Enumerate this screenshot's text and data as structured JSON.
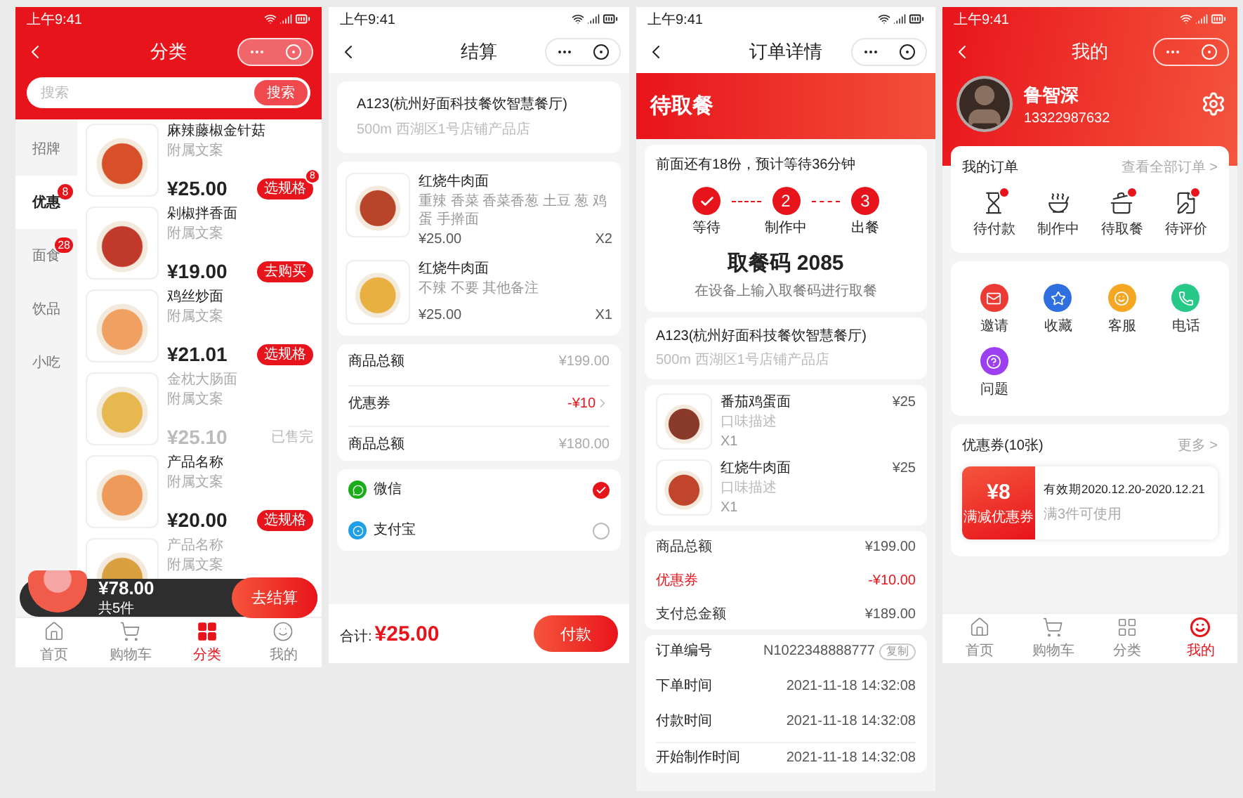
{
  "screens": [
    {
      "kind": "category",
      "status_time": "上午9:41",
      "title": "分类",
      "search": {
        "placeholder": "搜索",
        "button": "搜索"
      },
      "categories": [
        {
          "label": "招牌",
          "selected": false
        },
        {
          "label": "优惠",
          "selected": true,
          "badge": "8"
        },
        {
          "label": "面食",
          "selected": false,
          "badge": "28"
        },
        {
          "label": "饮品",
          "selected": false
        },
        {
          "label": "小吃",
          "selected": false
        }
      ],
      "products": [
        {
          "name": "麻辣藤椒金针菇",
          "subtitle": "附属文案",
          "price": "¥25.00",
          "action": "选规格",
          "sold_out": false,
          "badge": "8"
        },
        {
          "name": "剁椒拌香面",
          "subtitle": "附属文案",
          "price": "¥19.00",
          "action": "去购买",
          "sold_out": false
        },
        {
          "name": "鸡丝炒面",
          "subtitle": "附属文案",
          "price": "¥21.01",
          "action": "选规格",
          "sold_out": false
        },
        {
          "name": "金枕大肠面",
          "subtitle": "附属文案",
          "price": "¥25.10",
          "action": "已售完",
          "sold_out": true
        },
        {
          "name": "产品名称",
          "subtitle": "附属文案",
          "price": "¥20.00",
          "action": "选规格",
          "sold_out": false
        },
        {
          "name": "产品名称",
          "subtitle": "附属文案",
          "sold_out": true
        }
      ],
      "cart": {
        "total": "¥78.00",
        "count": "共5件",
        "button": "去结算"
      },
      "tabs": [
        {
          "label": "首页",
          "kind": "home",
          "selected": false
        },
        {
          "label": "购物车",
          "kind": "cart",
          "selected": false
        },
        {
          "label": "分类",
          "kind": "category",
          "selected": true
        },
        {
          "label": "我的",
          "kind": "mine",
          "selected": false
        }
      ]
    },
    {
      "kind": "checkout",
      "status_time": "上午9:41",
      "title": "结算",
      "store": {
        "name": "A123(杭州好面科技餐饮智慧餐厅)",
        "address": "500m 西湖区1号店铺产品店"
      },
      "items": [
        {
          "name": "红烧牛肉面",
          "spec": "重辣 香菜 香菜香葱 土豆 葱 鸡蛋 手擀面",
          "price": "¥25.00",
          "qty": "X2"
        },
        {
          "name": "红烧牛肉面",
          "spec": "不辣 不要 其他备注",
          "price": "¥25.00",
          "qty": "X1"
        }
      ],
      "summary": [
        {
          "label": "商品总额",
          "value": "¥199.00",
          "kind": "plain"
        },
        {
          "label": "优惠券",
          "value": "-¥10",
          "kind": "coupon"
        },
        {
          "label": "商品总额",
          "value": "¥180.00",
          "kind": "plain"
        }
      ],
      "payments": [
        {
          "label": "微信",
          "kind": "wechat",
          "selected": true
        },
        {
          "label": "支付宝",
          "kind": "alipay",
          "selected": false
        }
      ],
      "footer": {
        "label": "合计:",
        "total": "¥25.00",
        "button": "付款"
      }
    },
    {
      "kind": "order",
      "status_time": "上午9:41",
      "title": "订单详情",
      "banner": "待取餐",
      "queue": "前面还有18份，预计等待36分钟",
      "steps": [
        {
          "label": "等待",
          "kind": "done"
        },
        {
          "label": "制作中",
          "kind": "number",
          "number": "2"
        },
        {
          "label": "出餐",
          "kind": "number",
          "number": "3"
        }
      ],
      "code": "取餐码 2085",
      "code_hint": "在设备上输入取餐码进行取餐",
      "store": {
        "name": "A123(杭州好面科技餐饮智慧餐厅)",
        "address": "500m 西湖区1号店铺产品店"
      },
      "items": [
        {
          "name": "番茄鸡蛋面",
          "note": "口味描述",
          "qty": "X1",
          "price": "¥25"
        },
        {
          "name": "红烧牛肉面",
          "note": "口味描述",
          "qty": "X1",
          "price": "¥25"
        }
      ],
      "summary": [
        {
          "label": "商品总额",
          "value": "¥199.00",
          "highlight": false
        },
        {
          "label": "优惠券",
          "value": "-¥10.00",
          "highlight": true
        },
        {
          "label": "支付总金额",
          "value": "¥189.00",
          "highlight": false
        }
      ],
      "info": [
        {
          "label": "订单编号",
          "value": "N1022348888777",
          "action": "复制"
        },
        {
          "label": "下单时间",
          "value": "2021-11-18 14:32:08"
        },
        {
          "label": "付款时间",
          "value": "2021-11-18 14:32:08"
        },
        {
          "label": "开始制作时间",
          "value": "2021-11-18 14:32:08"
        }
      ]
    },
    {
      "kind": "profile",
      "status_time": "上午9:41",
      "title": "我的",
      "user": {
        "name": "鲁智深",
        "phone": "13322987632"
      },
      "orders": {
        "title": "我的订单",
        "link": "查看全部订单 >",
        "items": [
          {
            "label": "待付款",
            "kind": "pay",
            "badge": true
          },
          {
            "label": "制作中",
            "kind": "cooking",
            "badge": false
          },
          {
            "label": "待取餐",
            "kind": "pickup",
            "badge": true
          },
          {
            "label": "待评价",
            "kind": "review",
            "badge": true
          }
        ]
      },
      "services": [
        {
          "label": "邀请",
          "kind": "invite",
          "color": "#ec3a35"
        },
        {
          "label": "收藏",
          "kind": "favorite",
          "color": "#2f6fe0"
        },
        {
          "label": "客服",
          "kind": "service",
          "color": "#f5a623"
        },
        {
          "label": "电话",
          "kind": "phone",
          "color": "#27c989"
        },
        {
          "label": "问题",
          "kind": "help",
          "color": "#9b3ff0"
        }
      ],
      "coupons": {
        "title": "优惠券(10张)",
        "link": "更多 >",
        "coupon": {
          "amount": "¥8",
          "name": "满减优惠券",
          "validity": "有效期2020.12.20-2020.12.21",
          "condition": "满3件可使用"
        }
      },
      "tabs": [
        {
          "label": "首页",
          "kind": "home",
          "selected": false
        },
        {
          "label": "购物车",
          "kind": "cart",
          "selected": false
        },
        {
          "label": "分类",
          "kind": "category",
          "selected": false
        },
        {
          "label": "我的",
          "kind": "mine",
          "selected": true
        }
      ]
    }
  ]
}
